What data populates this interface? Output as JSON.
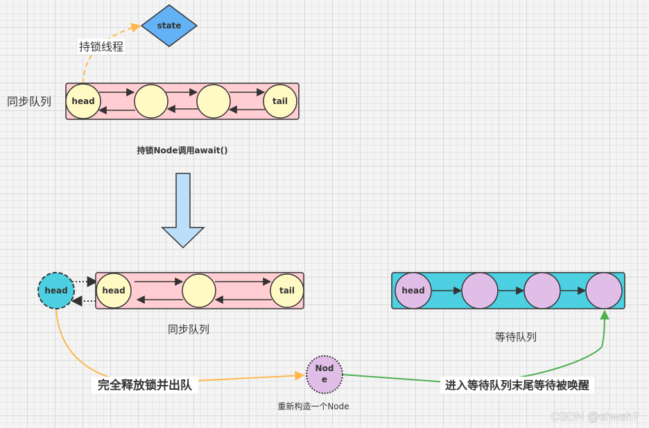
{
  "state_node": {
    "label": "state",
    "color": "#63b2f5"
  },
  "lock_holder_label": "持锁线程",
  "top_sync_queue": {
    "side_label": "同步队列",
    "nodes": [
      "head",
      "",
      "",
      "tail"
    ],
    "fill": "#ffcdd2",
    "node_fill": "#fff9c4"
  },
  "await_caption": "持锁Node调用await()",
  "transition_arrow": {
    "color": "#bbdefb"
  },
  "detached_head": {
    "label": "head",
    "color": "#4dd0e1"
  },
  "bottom_sync_queue": {
    "caption": "同步队列",
    "nodes": [
      "head",
      "",
      "tail"
    ]
  },
  "condition_queue": {
    "caption": "等待队列",
    "nodes": [
      "head",
      "",
      "",
      ""
    ],
    "fill": "#4dd0e1",
    "node_fill": "#e1bee7"
  },
  "new_node": {
    "label_line1": "Nod",
    "label_line2": "e",
    "caption": "重新构造一个Node"
  },
  "release_label": "完全释放锁并出队",
  "enqueue_label": "进入等待队列末尾等待被唤醒",
  "colors": {
    "orange": "#ffb74d",
    "green": "#4caf50",
    "stroke": "#333333"
  },
  "watermark": "CSDN @shwsh7"
}
